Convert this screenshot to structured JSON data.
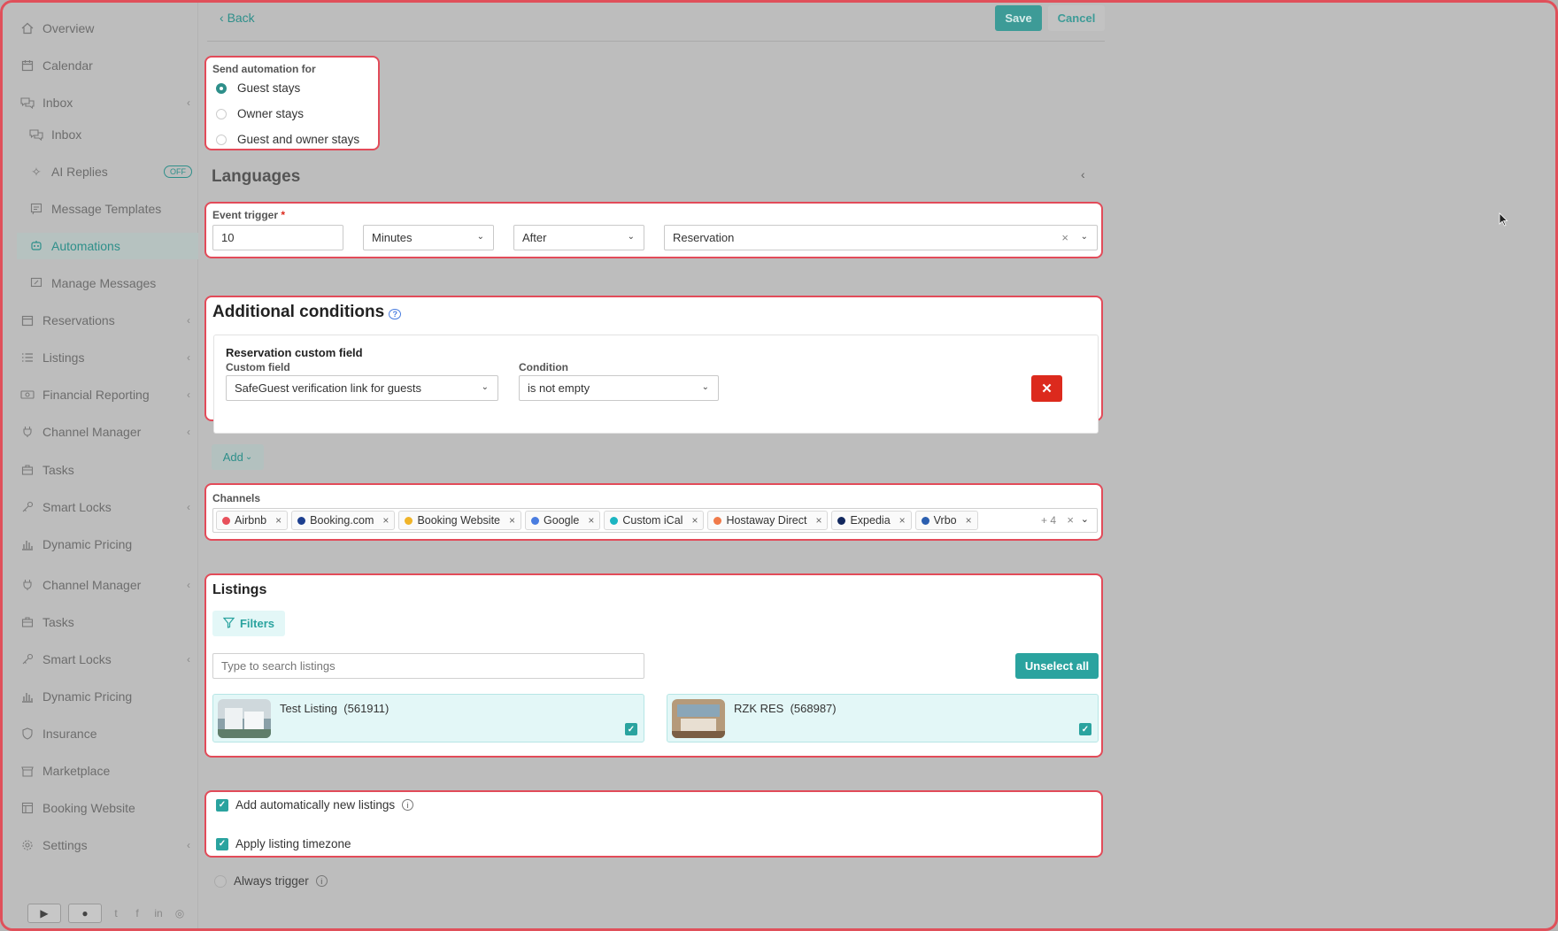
{
  "sidebar": {
    "items": [
      {
        "label": "Overview",
        "icon": "home-icon"
      },
      {
        "label": "Calendar",
        "icon": "calendar-icon"
      },
      {
        "label": "Inbox",
        "icon": "chat-icon"
      },
      {
        "label": "Inbox",
        "icon": "chat-icon"
      },
      {
        "label": "AI Replies",
        "icon": "sparkle-icon",
        "badge": "OFF"
      },
      {
        "label": "Message Templates",
        "icon": "template-icon"
      },
      {
        "label": "Automations",
        "icon": "automation-icon"
      },
      {
        "label": "Manage Messages",
        "icon": "edit-message-icon"
      },
      {
        "label": "Reservations",
        "icon": "reservations-icon"
      },
      {
        "label": "Listings",
        "icon": "list-icon"
      },
      {
        "label": "Financial Reporting",
        "icon": "money-icon"
      },
      {
        "label": "Channel Manager",
        "icon": "plug-icon"
      },
      {
        "label": "Tasks",
        "icon": "briefcase-icon"
      },
      {
        "label": "Smart Locks",
        "icon": "key-icon"
      },
      {
        "label": "Dynamic Pricing",
        "icon": "bar-chart-icon"
      },
      {
        "label": "Channel Manager",
        "icon": "plug-icon"
      },
      {
        "label": "Tasks",
        "icon": "briefcase-icon"
      },
      {
        "label": "Smart Locks",
        "icon": "key-icon"
      },
      {
        "label": "Dynamic Pricing",
        "icon": "bar-chart-icon"
      },
      {
        "label": "Insurance",
        "icon": "shield-icon"
      },
      {
        "label": "Marketplace",
        "icon": "marketplace-icon"
      },
      {
        "label": "Booking Website",
        "icon": "website-icon"
      },
      {
        "label": "Settings",
        "icon": "gear-icon"
      }
    ]
  },
  "topbar": {
    "back": "Back",
    "save": "Save",
    "cancel": "Cancel"
  },
  "send_for": {
    "label": "Send automation for",
    "options": [
      "Guest stays",
      "Owner stays",
      "Guest and owner stays"
    ],
    "selected": "Guest stays"
  },
  "languages": {
    "heading": "Languages"
  },
  "event_trigger": {
    "label": "Event trigger",
    "required_mark": "*",
    "amount": "10",
    "unit": "Minutes",
    "relation": "After",
    "event": "Reservation"
  },
  "conditions": {
    "heading": "Additional conditions",
    "group_title": "Reservation custom field",
    "custom_field_label": "Custom field",
    "custom_field_value": "SafeGuest verification link for guests",
    "condition_label": "Condition",
    "condition_value": "is not empty",
    "add_label": "Add"
  },
  "channels": {
    "label": "Channels",
    "items": [
      {
        "name": "Airbnb",
        "color": "#e8505b"
      },
      {
        "name": "Booking.com",
        "color": "#1d3f8f"
      },
      {
        "name": "Booking Website",
        "color": "#f0b429"
      },
      {
        "name": "Google",
        "color": "#4a7de0"
      },
      {
        "name": "Custom iCal",
        "color": "#1cb5c2"
      },
      {
        "name": "Hostaway Direct",
        "color": "#f07a4a"
      },
      {
        "name": "Expedia",
        "color": "#12285e"
      },
      {
        "name": "Vrbo",
        "color": "#2b5fb0"
      }
    ],
    "more": "+ 4"
  },
  "listings": {
    "heading": "Listings",
    "filters_label": "Filters",
    "search_placeholder": "Type to search listings",
    "unselect_all": "Unselect all",
    "items": [
      {
        "name": "Test Listing",
        "id": "(561911)",
        "checked": true
      },
      {
        "name": "RZK RES",
        "id": "(568987)",
        "checked": true
      }
    ]
  },
  "options": {
    "add_new_listings": "Add automatically new listings",
    "apply_timezone": "Apply listing timezone",
    "always_trigger": "Always trigger"
  },
  "colors": {
    "accent": "#2aa39f",
    "highlight": "#e24b59",
    "danger": "#dc2a1d"
  }
}
